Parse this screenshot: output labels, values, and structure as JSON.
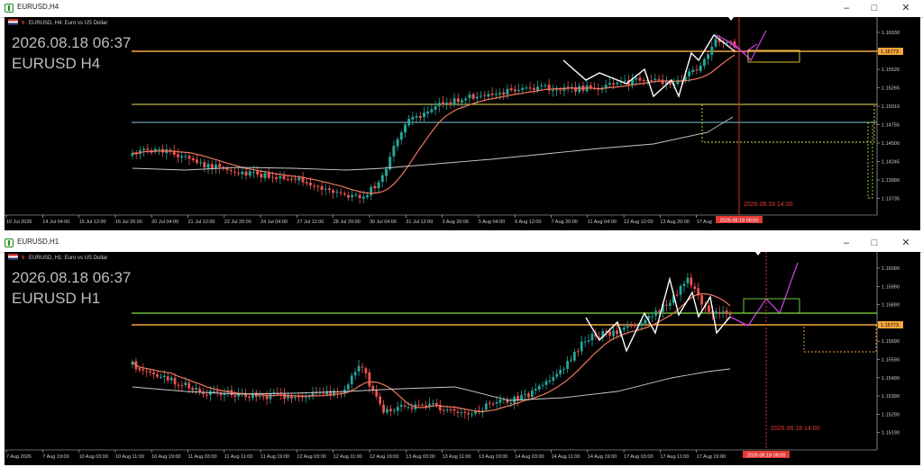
{
  "charts": [
    {
      "id": "h4",
      "window_title": "EURUSD,H4",
      "header": "EURUSD, H4: Euro vs US Dollar",
      "overlay_datetime": "2026.08.18 06:37",
      "overlay_symbol": "EURUSD H4",
      "vline_label": "2026.08.18 14:00",
      "current_time_label": "2026.08.18 08:00",
      "current_price_label": "1.15773",
      "y_ticks": [
        "1.16030",
        "1.15773",
        "1.15526",
        "1.15265",
        "1.15010",
        "1.14755",
        "1.14500",
        "1.14245",
        "1.13990",
        "1.13735"
      ],
      "x_ticks": [
        "10 Jul 2026",
        "14 Jul 04:00",
        "15 Jul 12:00",
        "16 Jul 20:00",
        "20 Jul 04:00",
        "21 Jul 12:00",
        "22 Jul 20:00",
        "24 Jul 04:00",
        "27 Jul 12:00",
        "28 Jul 20:00",
        "30 Jul 04:00",
        "31 Jul 12:00",
        "3 Aug 20:00",
        "5 Aug 04:00",
        "6 Aug 12:00",
        "7 Aug 20:00",
        "11 Aug 04:00",
        "12 Aug 12:00",
        "13 Aug 20:00",
        "17 Aug"
      ],
      "colors": {
        "bull": "#26a69a",
        "bear": "#ef5350",
        "ma_fast": "#f0765e",
        "ma_slow": "#c8c8c8",
        "level_orange": "#f6a63d",
        "level_yellow": "#e8e05a",
        "level_cyan": "#7ec3dd",
        "zigzag": "#ffffff",
        "projection": "#c13fd6",
        "vline": "#e53935"
      }
    },
    {
      "id": "h1",
      "window_title": "EURUSD,H1",
      "header": "EURUSD, H1: Euro vs US Dollar",
      "overlay_datetime": "2026.08.18 06:37",
      "overlay_symbol": "EURUSD H1",
      "vline_label": "2026.08.18 14:00",
      "current_time_label": "2026.08.18 08:00",
      "current_price_label": "1.15773",
      "y_ticks": [
        "1.16090",
        "1.15990",
        "1.15890",
        "1.15790",
        "1.15690",
        "1.15590",
        "1.15490",
        "1.15390",
        "1.15290",
        "1.15190"
      ],
      "x_ticks": [
        "7 Aug 2026",
        "7 Aug 19:00",
        "10 Aug 03:00",
        "10 Aug 11:00",
        "10 Aug 19:00",
        "11 Aug 03:00",
        "11 Aug 11:00",
        "11 Aug 19:00",
        "12 Aug 03:00",
        "12 Aug 11:00",
        "12 Aug 19:00",
        "13 Aug 03:00",
        "13 Aug 11:00",
        "13 Aug 19:00",
        "14 Aug 03:00",
        "14 Aug 11:00",
        "14 Aug 19:00",
        "17 Aug 03:00",
        "17 Aug 11:00",
        "17 Aug 19:00"
      ],
      "colors": {
        "bull": "#26a69a",
        "bear": "#ef5350",
        "ma_fast": "#f0765e",
        "ma_slow": "#c8c8c8",
        "level_orange": "#f6a63d",
        "level_green": "#7ddc3e",
        "zigzag": "#ffffff",
        "projection": "#c13fd6",
        "vline": "#e53935"
      }
    }
  ]
}
